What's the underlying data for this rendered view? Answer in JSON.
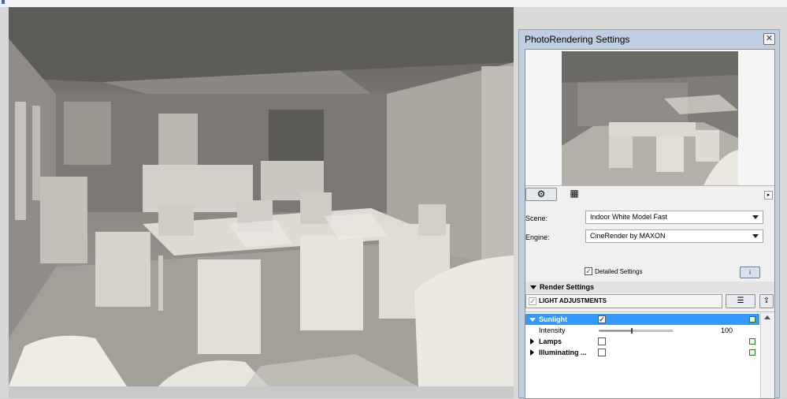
{
  "palette": {
    "title": "PhotoRendering Settings",
    "close_glyph": "✕",
    "tabs": [
      {
        "icon": "gear-icon",
        "glyph": "⚙"
      },
      {
        "icon": "layout-icon",
        "glyph": "▦"
      }
    ],
    "expand_glyph": "▸",
    "scene": {
      "label": "Scene:",
      "value": "Indoor White Model Fast"
    },
    "engine": {
      "label": "Engine:",
      "value": "CineRender by MAXON"
    },
    "detailed": {
      "label": "Detailed Settings",
      "checked": "✓",
      "info_glyph": "i"
    },
    "render_settings_label": "Render Settings",
    "light_adjustments": {
      "label": "LIGHT ADJUSTMENTS",
      "check": "✓"
    },
    "tree": {
      "sunlight": {
        "label": "Sunlight",
        "check": "✓"
      },
      "intensity": {
        "label": "Intensity",
        "value": "100",
        "level_percent": 45
      },
      "lamps": {
        "label": "Lamps"
      },
      "illuminating": {
        "label": "Illuminating ..."
      }
    }
  },
  "colors": {
    "accent": "#3399ff",
    "palette_frame": "#bfcfe0"
  }
}
